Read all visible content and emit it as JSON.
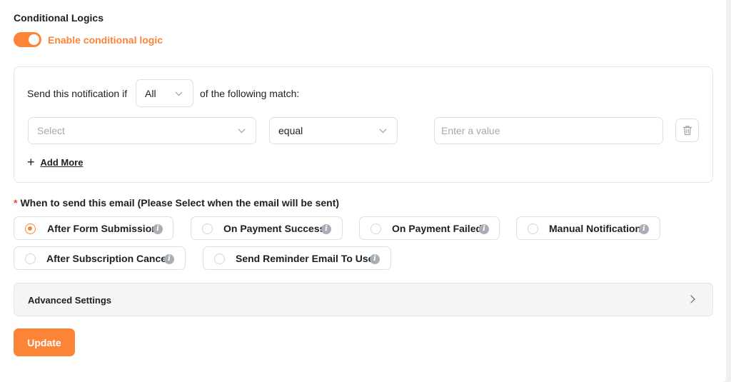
{
  "section": {
    "title": "Conditional Logics"
  },
  "toggle": {
    "label": "Enable conditional logic",
    "enabled": true
  },
  "condition": {
    "prefix": "Send this notification if",
    "match_value": "All",
    "suffix": "of the following match:",
    "field_placeholder": "Select",
    "operator_value": "equal",
    "value_placeholder": "Enter a value",
    "add_more_label": "Add More"
  },
  "when": {
    "required_mark": "*",
    "label": "When to send this email (Please Select when the email will be sent)",
    "options": [
      {
        "label": "After Form Submission",
        "checked": true
      },
      {
        "label": "On Payment Success",
        "checked": false
      },
      {
        "label": "On Payment Failed",
        "checked": false
      },
      {
        "label": "Manual Notification",
        "checked": false
      },
      {
        "label": "After Subscription Cancel",
        "checked": false
      },
      {
        "label": "Send Reminder Email To User",
        "checked": false
      }
    ],
    "info_glyph": "i"
  },
  "advanced": {
    "label": "Advanced Settings"
  },
  "actions": {
    "update_label": "Update"
  },
  "colors": {
    "accent": "#fb8437",
    "required": "#f04438",
    "text": "#1e1f21"
  }
}
